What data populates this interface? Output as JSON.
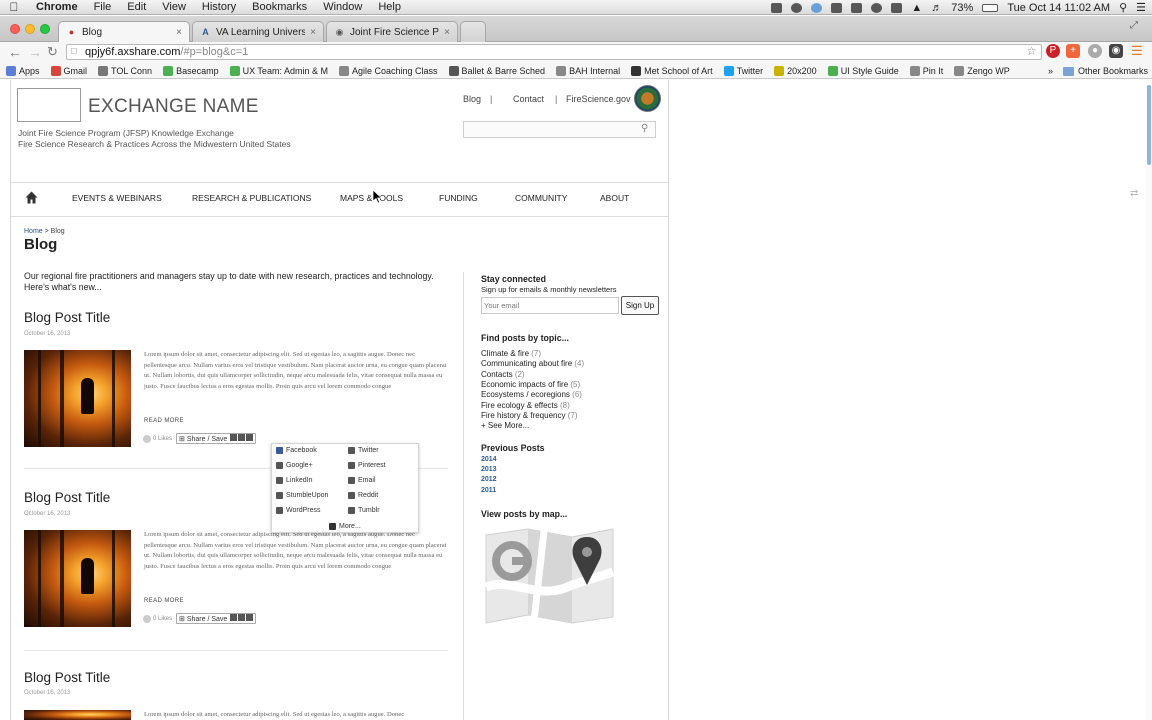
{
  "menubar": {
    "apple": "",
    "app": "Chrome",
    "items": [
      "File",
      "Edit",
      "View",
      "History",
      "Bookmarks",
      "Window",
      "Help"
    ],
    "battery": "73%",
    "clock": "Tue Oct 14  11:02 AM"
  },
  "tabs": [
    {
      "label": "Blog",
      "active": true
    },
    {
      "label": "VA Learning University",
      "active": false
    },
    {
      "label": "Joint Fire Science Program",
      "active": false
    }
  ],
  "url": {
    "host": "qpjy6f.axshare.com",
    "path": "/#p=blog&c=1"
  },
  "bookmarks": [
    {
      "label": "Apps",
      "icon": "apps-icon",
      "color": "#5b7fd6"
    },
    {
      "label": "Gmail",
      "icon": "gmail-icon",
      "color": "#d44638"
    },
    {
      "label": "TOL Conn",
      "icon": "key-icon",
      "color": "#777777"
    },
    {
      "label": "Basecamp",
      "icon": "basecamp-icon",
      "color": "#4caf50"
    },
    {
      "label": "UX Team: Admin & M",
      "icon": "basecamp-icon",
      "color": "#4caf50"
    },
    {
      "label": "Agile Coaching Class",
      "icon": "page-icon",
      "color": "#888888"
    },
    {
      "label": "Ballet & Barre Sched",
      "icon": "circle-icon",
      "color": "#555555"
    },
    {
      "label": "BAH Internal",
      "icon": "page-icon",
      "color": "#888888"
    },
    {
      "label": "Met School of Art",
      "icon": "met-icon",
      "color": "#333333"
    },
    {
      "label": "Twitter",
      "icon": "twitter-icon",
      "color": "#1da1f2"
    },
    {
      "label": "20x200",
      "icon": "20x200-icon",
      "color": "#c8b400"
    },
    {
      "label": "UI Style Guide",
      "icon": "basecamp-icon",
      "color": "#4caf50"
    },
    {
      "label": "Pin It",
      "icon": "page-icon",
      "color": "#888888"
    },
    {
      "label": "Zengo WP",
      "icon": "page-icon",
      "color": "#888888"
    }
  ],
  "bookmarks_more": "»",
  "other_bookmarks": "Other Bookmarks",
  "site": {
    "name": "EXCHANGE NAME",
    "tagline1": "Joint Fire Science Program (JFSP) Knowledge Exchange",
    "tagline2": "Fire Science Research & Practices Across the Midwestern United States",
    "toplinks": [
      "Blog",
      "Contact",
      "FireScience.gov"
    ],
    "separator": "|",
    "nav": [
      "EVENTS & WEBINARS",
      "RESEARCH & PUBLICATIONS",
      "MAPS & TOOLS",
      "FUNDING",
      "COMMUNITY",
      "ABOUT"
    ],
    "breadcrumb_home": "Home",
    "breadcrumb_sep": " > ",
    "breadcrumb_current": "Blog",
    "page_title": "Blog",
    "intro": "Our regional fire practitioners and managers stay up to date with new research, practices and technology. Here's what's new..."
  },
  "posts": [
    {
      "title": "Blog Post Title",
      "date": "October 16, 2013",
      "body": "Lorem ipsum dolor sit amet, consectetur adipiscing elit. Sed ut egestas leo, a sagittis augue. Donec nec pellentesque arcu. Nullam varius eros vel tristique vestibulum. Nam placerat auctor urna, eu congue quam placerat ut. Nullam lobortis, dui quis ullamcorper sollicitudin, neque arcu malesuada felis, vitae consequat nulla massa eu justo. Fusce faucibus lectus a eros egestas mollis. Proin quis arcu vel lorem commodo congue",
      "read_more": "READ MORE",
      "likes": "0 Likes",
      "share": "Share / Save"
    },
    {
      "title": "Blog Post Title",
      "date": "October 16, 2013",
      "body": "Lorem ipsum dolor sit amet, consectetur adipiscing elit. Sed ut egestas leo, a sagittis augue. Donec nec pellentesque arcu. Nullam varius eros vel tristique vestibulum. Nam placerat auctor urna, eu congue quam placerat ut. Nullam lobortis, dui quis ullamcorper sollicitudin, neque arcu malesuada felis, vitae consequat nulla massa eu justo. Fusce faucibus lectus a eros egestas mollis. Proin quis arcu vel lorem commodo congue",
      "read_more": "READ MORE",
      "likes": "0 Likes",
      "share": "Share / Save"
    },
    {
      "title": "Blog Post Title",
      "date": "October 16, 2013",
      "body": "Lorem ipsum dolor sit amet, consectetur adipiscing elit. Sed ut egestas leo, a sagittis augue. Donec",
      "read_more": "",
      "likes": "",
      "share": ""
    }
  ],
  "share_popup": {
    "items": [
      {
        "label": "Facebook",
        "icon": "facebook-icon",
        "color": "#3b5998"
      },
      {
        "label": "Twitter",
        "icon": "twitter-icon",
        "color": "#555555"
      },
      {
        "label": "Google+",
        "icon": "googleplus-icon",
        "color": "#555555"
      },
      {
        "label": "Pinterest",
        "icon": "pinterest-icon",
        "color": "#555555"
      },
      {
        "label": "LinkedIn",
        "icon": "linkedin-icon",
        "color": "#555555"
      },
      {
        "label": "Email",
        "icon": "email-icon",
        "color": "#555555"
      },
      {
        "label": "StumbleUpon",
        "icon": "stumbleupon-icon",
        "color": "#555555"
      },
      {
        "label": "Reddit",
        "icon": "reddit-icon",
        "color": "#555555"
      },
      {
        "label": "WordPress",
        "icon": "wordpress-icon",
        "color": "#555555"
      },
      {
        "label": "Tumblr",
        "icon": "tumblr-icon",
        "color": "#555555"
      }
    ],
    "more": "More..."
  },
  "sidebar": {
    "stay_connected": "Stay connected",
    "stay_sub": "Sign up for emails & monthly newsletters",
    "email_placeholder": "Your email",
    "signup": "Sign Up",
    "topics_heading": "Find posts by topic...",
    "topics": [
      {
        "label": "Climate & fire",
        "count": "(7)"
      },
      {
        "label": "Communicating about fire",
        "count": "(4)"
      },
      {
        "label": "Contacts",
        "count": "(2)"
      },
      {
        "label": "Economic impacts of fire",
        "count": "(5)"
      },
      {
        "label": "Ecosystems / ecoregions",
        "count": "(6)"
      },
      {
        "label": "Fire ecology & effects",
        "count": "(8)"
      },
      {
        "label": "Fire history & frequency",
        "count": "(7)"
      }
    ],
    "see_more": "+ See More...",
    "previous_heading": "Previous Posts",
    "years": [
      "2014",
      "2013",
      "2012",
      "2011"
    ],
    "map_heading": "View posts by map..."
  },
  "colors": {
    "link": "#1f4f8f",
    "year_link": "#2a5aa0",
    "accent_scroll": "#8fb4e0"
  }
}
